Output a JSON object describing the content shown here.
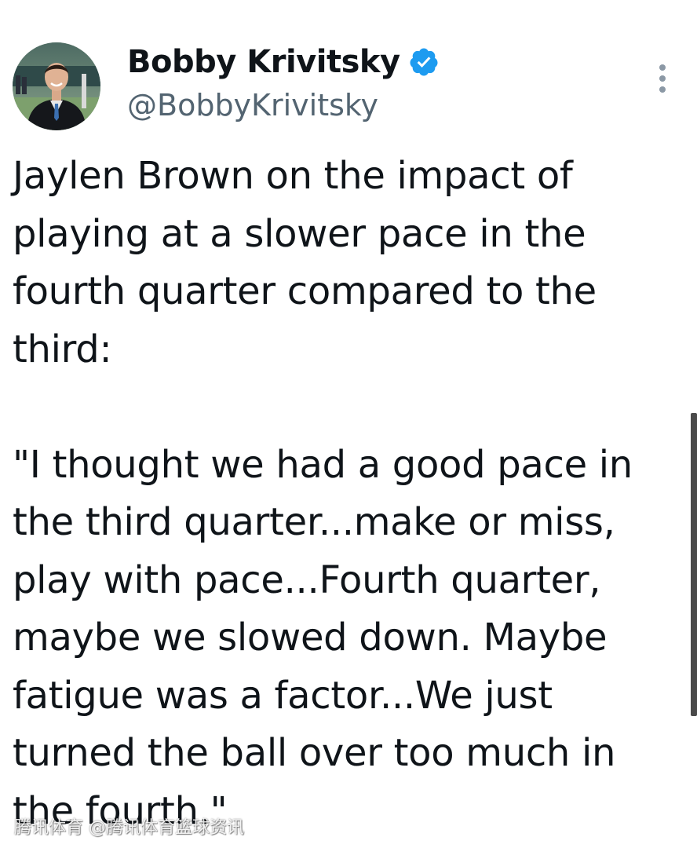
{
  "tweet": {
    "author": {
      "display_name": "Bobby Krivitsky",
      "handle": "@BobbyKrivitsky",
      "verified": true,
      "verified_color": "#1d9bf0"
    },
    "more_icon": "more-vertical-icon",
    "text": "Jaylen Brown on the impact of\nplaying at a slower pace in the\nfourth quarter compared to the\nthird:\n\n\"I thought we had a good pace in\nthe third quarter...make or miss,\nplay with pace...Fourth quarter,\nmaybe we slowed down. Maybe\nfatigue was a factor...We just\nturned the ball over too much in\nthe fourth.\""
  },
  "watermark": {
    "text": "腾讯体育 @腾讯体育篮球资讯"
  }
}
